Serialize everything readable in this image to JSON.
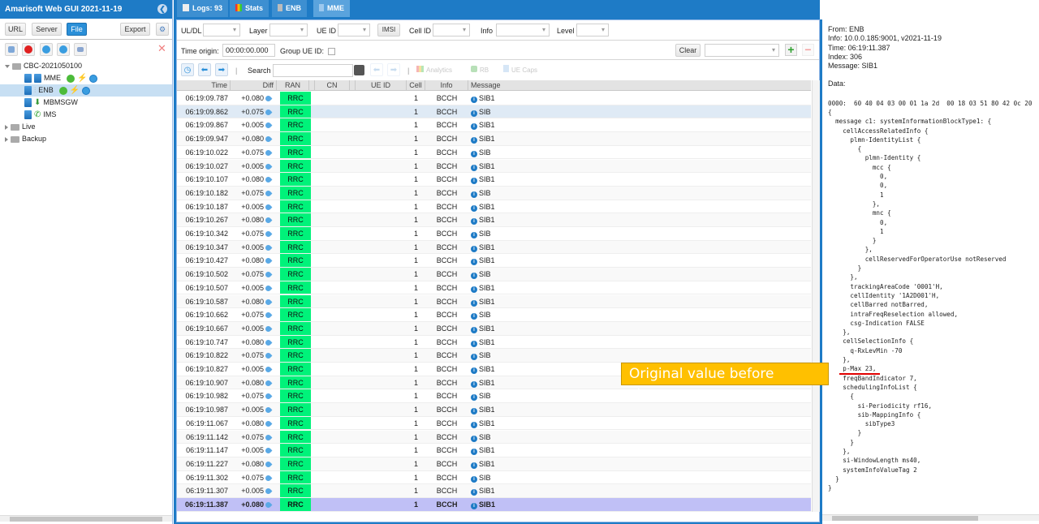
{
  "app": {
    "title": "Amarisoft Web GUI 2021-11-19"
  },
  "left": {
    "buttons": {
      "url": "URL",
      "server": "Server",
      "file": "File",
      "export": "Export"
    },
    "tree": {
      "root": "CBC-2021050100",
      "children": [
        {
          "label": "MME",
          "status": [
            "ok",
            "bolt",
            "play"
          ]
        },
        {
          "label": "ENB",
          "status": [
            "ok",
            "bolt",
            "play"
          ],
          "selected": true
        },
        {
          "label": "MBMSGW"
        },
        {
          "label": "IMS"
        }
      ],
      "folders": [
        "Live",
        "Backup"
      ]
    }
  },
  "tabs": [
    {
      "label": "Logs: 93",
      "icon": "document-icon"
    },
    {
      "label": "Stats",
      "icon": "chart-icon"
    },
    {
      "label": "ENB",
      "icon": "antenna-icon"
    },
    {
      "label": "MME",
      "icon": "server-icon",
      "active": true
    }
  ],
  "filters": {
    "uldl": "UL/DL",
    "layer": "Layer",
    "ueid": "UE ID",
    "imsi": "IMSI",
    "cellid": "Cell ID",
    "info": "Info",
    "level": "Level",
    "time_origin_label": "Time origin:",
    "time_origin_value": "00:00:00.000",
    "group_ue_id": "Group UE ID:",
    "clear": "Clear"
  },
  "toolbar": {
    "search_label": "Search",
    "search_value": "",
    "analytics": "Analytics",
    "rb": "RB",
    "ue_caps": "UE Caps"
  },
  "grid": {
    "columns": [
      "Time",
      "Diff",
      "RAN",
      "CN",
      "UE ID",
      "Cell",
      "Info",
      "Message"
    ],
    "rows": [
      [
        "06:19:09.787",
        "+0.080",
        "RRC",
        "",
        "",
        "1",
        "BCCH",
        "SIB1"
      ],
      [
        "06:19:09.862",
        "+0.075",
        "RRC",
        "",
        "",
        "1",
        "BCCH",
        "SIB"
      ],
      [
        "06:19:09.867",
        "+0.005",
        "RRC",
        "",
        "",
        "1",
        "BCCH",
        "SIB1"
      ],
      [
        "06:19:09.947",
        "+0.080",
        "RRC",
        "",
        "",
        "1",
        "BCCH",
        "SIB1"
      ],
      [
        "06:19:10.022",
        "+0.075",
        "RRC",
        "",
        "",
        "1",
        "BCCH",
        "SIB"
      ],
      [
        "06:19:10.027",
        "+0.005",
        "RRC",
        "",
        "",
        "1",
        "BCCH",
        "SIB1"
      ],
      [
        "06:19:10.107",
        "+0.080",
        "RRC",
        "",
        "",
        "1",
        "BCCH",
        "SIB1"
      ],
      [
        "06:19:10.182",
        "+0.075",
        "RRC",
        "",
        "",
        "1",
        "BCCH",
        "SIB"
      ],
      [
        "06:19:10.187",
        "+0.005",
        "RRC",
        "",
        "",
        "1",
        "BCCH",
        "SIB1"
      ],
      [
        "06:19:10.267",
        "+0.080",
        "RRC",
        "",
        "",
        "1",
        "BCCH",
        "SIB1"
      ],
      [
        "06:19:10.342",
        "+0.075",
        "RRC",
        "",
        "",
        "1",
        "BCCH",
        "SIB"
      ],
      [
        "06:19:10.347",
        "+0.005",
        "RRC",
        "",
        "",
        "1",
        "BCCH",
        "SIB1"
      ],
      [
        "06:19:10.427",
        "+0.080",
        "RRC",
        "",
        "",
        "1",
        "BCCH",
        "SIB1"
      ],
      [
        "06:19:10.502",
        "+0.075",
        "RRC",
        "",
        "",
        "1",
        "BCCH",
        "SIB"
      ],
      [
        "06:19:10.507",
        "+0.005",
        "RRC",
        "",
        "",
        "1",
        "BCCH",
        "SIB1"
      ],
      [
        "06:19:10.587",
        "+0.080",
        "RRC",
        "",
        "",
        "1",
        "BCCH",
        "SIB1"
      ],
      [
        "06:19:10.662",
        "+0.075",
        "RRC",
        "",
        "",
        "1",
        "BCCH",
        "SIB"
      ],
      [
        "06:19:10.667",
        "+0.005",
        "RRC",
        "",
        "",
        "1",
        "BCCH",
        "SIB1"
      ],
      [
        "06:19:10.747",
        "+0.080",
        "RRC",
        "",
        "",
        "1",
        "BCCH",
        "SIB1"
      ],
      [
        "06:19:10.822",
        "+0.075",
        "RRC",
        "",
        "",
        "1",
        "BCCH",
        "SIB"
      ],
      [
        "06:19:10.827",
        "+0.005",
        "RRC",
        "",
        "",
        "1",
        "BCCH",
        "SIB1"
      ],
      [
        "06:19:10.907",
        "+0.080",
        "RRC",
        "",
        "",
        "1",
        "BCCH",
        "SIB1"
      ],
      [
        "06:19:10.982",
        "+0.075",
        "RRC",
        "",
        "",
        "1",
        "BCCH",
        "SIB"
      ],
      [
        "06:19:10.987",
        "+0.005",
        "RRC",
        "",
        "",
        "1",
        "BCCH",
        "SIB1"
      ],
      [
        "06:19:11.067",
        "+0.080",
        "RRC",
        "",
        "",
        "1",
        "BCCH",
        "SIB1"
      ],
      [
        "06:19:11.142",
        "+0.075",
        "RRC",
        "",
        "",
        "1",
        "BCCH",
        "SIB"
      ],
      [
        "06:19:11.147",
        "+0.005",
        "RRC",
        "",
        "",
        "1",
        "BCCH",
        "SIB1"
      ],
      [
        "06:19:11.227",
        "+0.080",
        "RRC",
        "",
        "",
        "1",
        "BCCH",
        "SIB1"
      ],
      [
        "06:19:11.302",
        "+0.075",
        "RRC",
        "",
        "",
        "1",
        "BCCH",
        "SIB"
      ],
      [
        "06:19:11.307",
        "+0.005",
        "RRC",
        "",
        "",
        "1",
        "BCCH",
        "SIB1"
      ],
      [
        "06:19:11.387",
        "+0.080",
        "RRC",
        "",
        "",
        "1",
        "BCCH",
        "SIB1"
      ]
    ],
    "selected_index": 30,
    "hover_index": 1
  },
  "detail": {
    "from": "From: ENB",
    "info": "Info: 10.0.0.185:9001, v2021-11-19",
    "time": "Time: 06:19:11.387",
    "index": "Index: 306",
    "message": "Message: SIB1",
    "data_label": "Data:",
    "hex": "0000:  60 40 04 03 00 01 1a 2d  00 18 03 51 80 42 0c 20",
    "decoded": "{\n  message c1: systemInformationBlockType1: {\n    cellAccessRelatedInfo {\n      plmn-IdentityList {\n        {\n          plmn-Identity {\n            mcc {\n              0,\n              0,\n              1\n            },\n            mnc {\n              0,\n              1\n            }\n          },\n          cellReservedForOperatorUse notReserved\n        }\n      },\n      trackingAreaCode '0001'H,\n      cellIdentity '1A2D001'H,\n      cellBarred notBarred,\n      intraFreqReselection allowed,\n      csg-Indication FALSE\n    },\n    cellSelectionInfo {\n      q-RxLevMin -70\n    },\n    p-Max 23,\n    freqBandIndicator 7,\n    schedulingInfoList {\n      {\n        si-Periodicity rf16,\n        sib-MappingInfo {\n          sibType3\n        }\n      }\n    },\n    si-WindowLength ms40,\n    systemInfoValueTag 2\n  }\n}"
  },
  "annotation": {
    "callout": "Original value before change",
    "callout_color": "#ffc000",
    "underline_color": "#e00000"
  },
  "colors": {
    "brand": "#1e7bc6",
    "ran_rrc": "#00f27a",
    "selected_row": "#c0c0f6"
  }
}
